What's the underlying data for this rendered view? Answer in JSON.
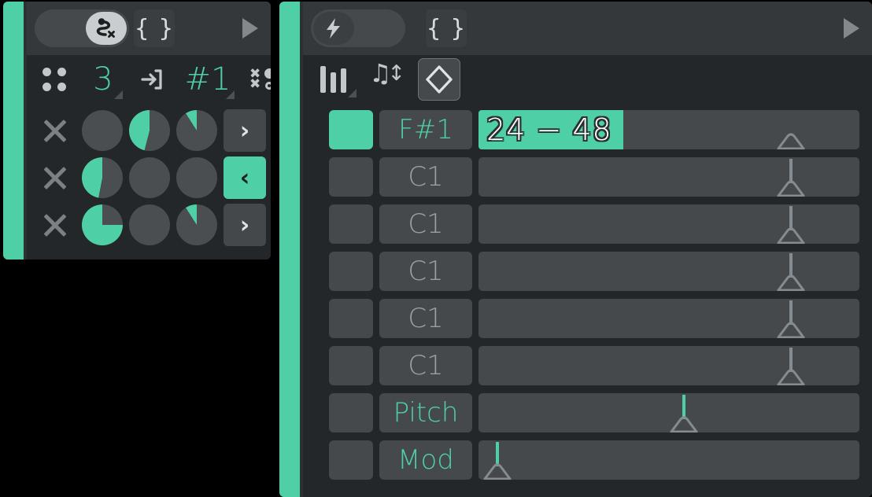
{
  "app": {
    "background_color": "#000000",
    "accent_color": "#4ecfa6",
    "panel_color": "#2e3133",
    "panel_dark_color": "#242729"
  },
  "left_panel": {
    "header": {
      "toggle": {
        "state": "on",
        "icon": "route-path-x-icon",
        "knob_side": "right"
      },
      "braces_button": {
        "label": "{ }",
        "icon": "curly-braces-icon"
      },
      "play_button": {
        "icon": "play-triangle-icon"
      }
    },
    "toolbar": {
      "items": [
        {
          "name": "grid-dots",
          "icon": "dot-grid-icon",
          "label": "",
          "type": "icon",
          "has_caret": false
        },
        {
          "name": "step-count",
          "icon": "",
          "label": "3",
          "type": "value",
          "has_caret": true
        },
        {
          "name": "input-route",
          "icon": "arrow-into-box-icon",
          "label": "",
          "type": "icon",
          "has_caret": false
        },
        {
          "name": "pattern-number",
          "icon": "",
          "label": "#1",
          "type": "value",
          "has_caret": true
        },
        {
          "name": "randomize",
          "icon": "x-dot-scatter-icon",
          "label": "",
          "type": "icon",
          "has_caret": true
        }
      ]
    },
    "rows": [
      {
        "clear_icon": "x-close-icon",
        "knobs": [
          {
            "name": "knob-r1-c1",
            "value_pct": 0
          },
          {
            "name": "knob-r1-c2",
            "value_pct": 46
          },
          {
            "name": "knob-r1-c3",
            "value_pct": 9
          }
        ],
        "arrow": {
          "label": "›",
          "icon": "chevron-right-icon",
          "active": false
        }
      },
      {
        "clear_icon": "x-close-icon",
        "knobs": [
          {
            "name": "knob-r2-c1",
            "value_pct": 47
          },
          {
            "name": "knob-r2-c2",
            "value_pct": 0
          },
          {
            "name": "knob-r2-c3",
            "value_pct": 0
          }
        ],
        "arrow": {
          "label": "‹",
          "icon": "chevron-left-icon",
          "active": true
        }
      },
      {
        "clear_icon": "x-close-icon",
        "knobs": [
          {
            "name": "knob-r3-c1",
            "value_pct": 75
          },
          {
            "name": "knob-r3-c2",
            "value_pct": 0
          },
          {
            "name": "knob-r3-c3",
            "value_pct": 9
          }
        ],
        "arrow": {
          "label": "›",
          "icon": "chevron-right-icon",
          "active": false
        }
      }
    ]
  },
  "right_panel": {
    "header": {
      "toggle": {
        "state": "off",
        "icon": "lightning-bolt-icon",
        "knob_side": "left"
      },
      "braces_button": {
        "label": "{ }",
        "icon": "curly-braces-icon"
      },
      "play_button": {
        "icon": "play-triangle-icon"
      }
    },
    "toolbar": {
      "items": [
        {
          "name": "mixer-sliders",
          "icon": "sliders-icon",
          "has_caret": true,
          "selected": false
        },
        {
          "name": "note-transpose",
          "icon": "note-up-down-icon",
          "has_caret": false,
          "selected": false
        },
        {
          "name": "range-diamond",
          "icon": "diamond-chevrons-icon",
          "has_caret": false,
          "selected": true
        }
      ]
    },
    "lanes": [
      {
        "name": "lane-fsharp1",
        "active": true,
        "label": "F#1",
        "label_teal": true,
        "value_text": "24 − 48",
        "bar_pct": 38,
        "marker": {
          "pos_pct": 78,
          "teal": false,
          "stem_height": 0
        },
        "selection_box": true
      },
      {
        "name": "lane-c1-a",
        "active": false,
        "label": "C1",
        "label_teal": false,
        "value_text": "",
        "bar_pct": 0,
        "marker": {
          "pos_pct": 78,
          "teal": false,
          "stem_height": 26
        },
        "selection_box": false
      },
      {
        "name": "lane-c1-b",
        "active": false,
        "label": "C1",
        "label_teal": false,
        "value_text": "",
        "bar_pct": 0,
        "marker": {
          "pos_pct": 78,
          "teal": false,
          "stem_height": 26
        },
        "selection_box": false
      },
      {
        "name": "lane-c1-c",
        "active": false,
        "label": "C1",
        "label_teal": false,
        "value_text": "",
        "bar_pct": 0,
        "marker": {
          "pos_pct": 78,
          "teal": false,
          "stem_height": 26
        },
        "selection_box": false
      },
      {
        "name": "lane-c1-d",
        "active": false,
        "label": "C1",
        "label_teal": false,
        "value_text": "",
        "bar_pct": 0,
        "marker": {
          "pos_pct": 78,
          "teal": false,
          "stem_height": 26
        },
        "selection_box": false
      },
      {
        "name": "lane-c1-e",
        "active": false,
        "label": "C1",
        "label_teal": false,
        "value_text": "",
        "bar_pct": 0,
        "marker": {
          "pos_pct": 78,
          "teal": false,
          "stem_height": 26
        },
        "selection_box": false
      },
      {
        "name": "lane-pitch",
        "active": false,
        "label": "Pitch",
        "label_teal": true,
        "value_text": "",
        "bar_pct": 0,
        "marker": {
          "pos_pct": 50,
          "teal": true,
          "stem_height": 26
        },
        "selection_box": false
      },
      {
        "name": "lane-mod",
        "active": false,
        "label": "Mod",
        "label_teal": true,
        "value_text": "",
        "bar_pct": 0,
        "marker": {
          "pos_pct": 1,
          "teal": true,
          "stem_height": 26
        },
        "selection_box": false
      }
    ]
  }
}
